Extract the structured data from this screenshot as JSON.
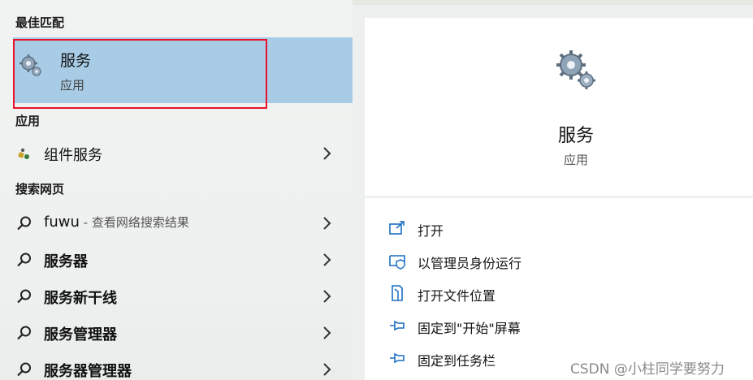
{
  "sections": {
    "best_match": "最佳匹配",
    "apps": "应用",
    "web_search": "搜索网页"
  },
  "best_match": {
    "title": "服务",
    "subtitle": "应用",
    "icon": "gears-icon"
  },
  "apps": [
    {
      "label": "组件服务",
      "icon": "component-services-icon"
    }
  ],
  "web_results": [
    {
      "label": "fuwu",
      "hint": " - 查看网络搜索结果",
      "bold": false
    },
    {
      "label": "服务器",
      "hint": "",
      "bold": true
    },
    {
      "label": "服务新干线",
      "hint": "",
      "bold": true
    },
    {
      "label": "服务管理器",
      "hint": "",
      "bold": true
    },
    {
      "label": "服务器管理器",
      "hint": "",
      "bold": true
    }
  ],
  "detail": {
    "title": "服务",
    "subtitle": "应用",
    "actions": [
      {
        "label": "打开",
        "icon": "open-icon"
      },
      {
        "label": "以管理员身份运行",
        "icon": "shield-icon"
      },
      {
        "label": "打开文件位置",
        "icon": "file-location-icon"
      },
      {
        "label": "固定到\"开始\"屏幕",
        "icon": "pin-icon"
      },
      {
        "label": "固定到任务栏",
        "icon": "pin-icon"
      }
    ]
  },
  "watermark": "CSDN @小柱同学要努力",
  "colors": {
    "selection": "#a8cce6",
    "highlight_border": "#e8112d",
    "accent_icon": "#1a6fc2"
  }
}
